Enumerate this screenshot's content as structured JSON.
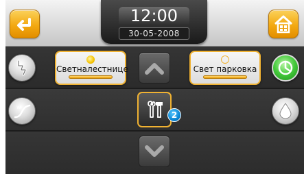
{
  "header": {
    "time": "12:00",
    "date": "30-05-2008",
    "back_icon": "back-arrow-icon",
    "home_icon": "house-icon"
  },
  "lights": [
    {
      "label": "Светналестнице",
      "state": "on"
    },
    {
      "label": "Свет парковка",
      "state": "off"
    }
  ],
  "side_buttons": {
    "left": [
      "power-icon",
      "wave-icon"
    ],
    "right": [
      "pie-chart-icon",
      "water-drop-icon"
    ]
  },
  "center": {
    "up_icon": "chevron-up-icon",
    "down_icon": "chevron-down-icon",
    "tools_icon": "wrench-hammer-icon",
    "tools_badge": "2"
  },
  "colors": {
    "accent": "#f0b232",
    "badge": "#0b86d4",
    "green": "#43c93a"
  }
}
